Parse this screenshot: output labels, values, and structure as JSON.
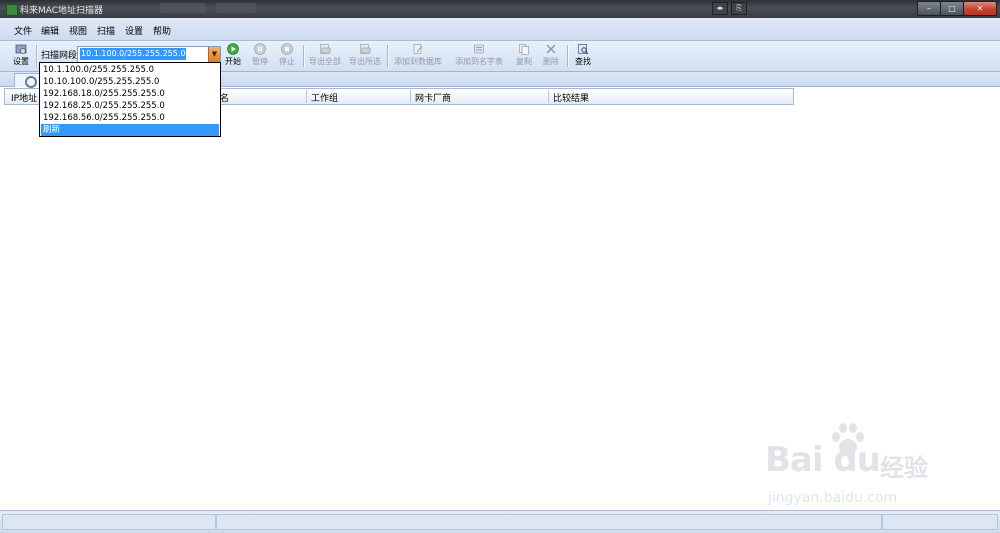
{
  "window": {
    "title": "科来MAC地址扫描器",
    "controls": {
      "minimize": "–",
      "maximize": "□",
      "close": "✕"
    }
  },
  "menubar": {
    "items": [
      "文件",
      "编辑",
      "视图",
      "扫描",
      "设置",
      "帮助"
    ]
  },
  "toolbar": {
    "settings_label": "设置",
    "segment_label": "扫描网段",
    "segment_value": "10.1.100.0/255.255.255.0",
    "start_label": "开始",
    "pause_label": "暂停",
    "stop_label": "停止",
    "export_all_label": "导出全部",
    "export_selected_label": "导出所选",
    "add_db_label": "添加到数据库",
    "add_list_label": "添加到名字表",
    "copy_label": "复制",
    "delete_label": "删除",
    "find_label": "查找"
  },
  "dropdown": {
    "options": [
      "10.1.100.0/255.255.255.0",
      "10.10.100.0/255.255.255.0",
      "192.168.18.0/255.255.255.0",
      "192.168.25.0/255.255.255.0",
      "192.168.56.0/255.255.255.0",
      "刷新"
    ],
    "selected_index": 5
  },
  "table": {
    "columns": [
      "IP地址",
      "机名",
      "工作组",
      "网卡厂商",
      "比较结果"
    ]
  },
  "watermark": {
    "brand": "Bai du",
    "cn": "经验",
    "url": "jingyan.baidu.com"
  },
  "icons": {
    "settings": "gear-icon",
    "start": "play-icon",
    "pause": "pause-icon",
    "stop": "stop-icon",
    "export_all": "export-all-icon",
    "export_selected": "export-selected-icon",
    "add_db": "database-add-icon",
    "add_list": "list-add-icon",
    "copy": "copy-icon",
    "delete": "delete-icon",
    "find": "find-icon",
    "tab": "search-icon"
  },
  "colors": {
    "selection": "#3399ff",
    "accent": "#e27a1e",
    "play": "#3da83d"
  }
}
